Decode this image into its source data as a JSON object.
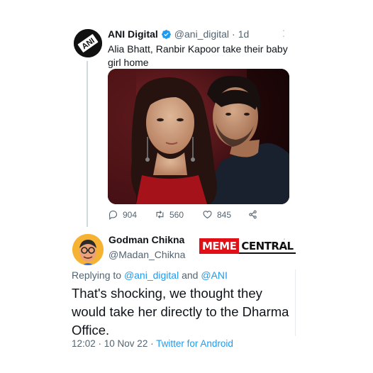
{
  "tweet": {
    "author_name": "ANI Digital",
    "handle": "@ani_digital",
    "separator": "·",
    "time": "1d",
    "text": "Alia Bhatt, Ranbir Kapoor take their baby girl home",
    "avatar_text": "ANI",
    "stats": {
      "replies": "904",
      "retweets": "560",
      "likes": "845"
    }
  },
  "reply": {
    "author_name": "Godman Chikna",
    "handle": "@Madan_Chikna",
    "replying_prefix": "Replying to",
    "mention_1": "@ani_digital",
    "and_word": "and",
    "mention_2": "@ANI",
    "text": "That's shocking, we thought they would take her directly to the Dharma Office.",
    "timestamp": "12:02 · 10 Nov 22 ·",
    "source": "Twitter for Android"
  },
  "watermark": {
    "part_1": "MEME",
    "part_2": "CENTRAL"
  },
  "colors": {
    "accent": "#1d9bf0",
    "secondary_text": "#536471",
    "verified_badge": "#1d9bf0",
    "meme_red": "#e10f16"
  },
  "icons": {
    "more": "more-vertical-icon",
    "verified": "verified-badge-icon",
    "reply": "reply-icon",
    "retweet": "retweet-icon",
    "like": "heart-icon",
    "share": "share-icon"
  }
}
